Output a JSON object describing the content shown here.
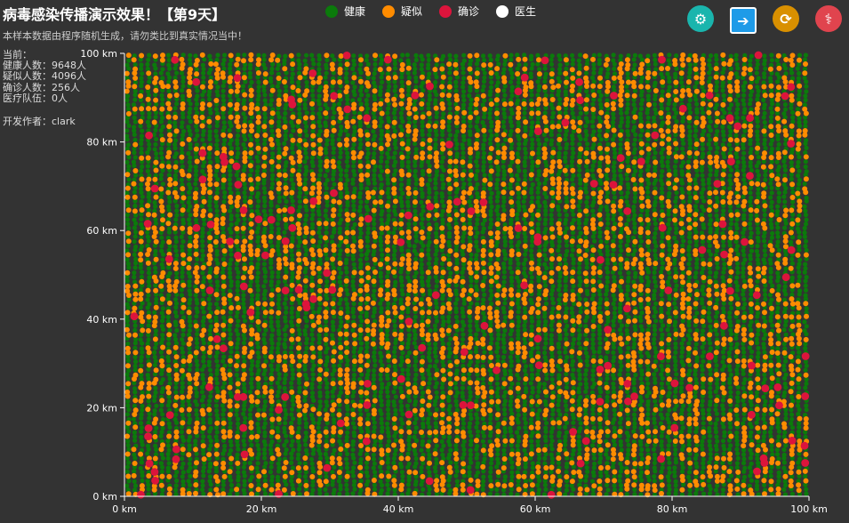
{
  "header": {
    "title": "病毒感染传播演示效果！【第9天】",
    "subtitle": "本样本数据由程序随机生成，请勿类比到真实情况当中！"
  },
  "stats": {
    "label": "当前：",
    "healthy": "健康人数：9648人",
    "suspected": "疑似人数：4096人",
    "confirmed": "确诊人数：256人",
    "medical": "医疗队伍：0人",
    "author": "开发作者：clark"
  },
  "legend": [
    {
      "label": "健康",
      "color": "#0b7a0b"
    },
    {
      "label": "疑似",
      "color": "#ff8c00"
    },
    {
      "label": "确诊",
      "color": "#dc143c"
    },
    {
      "label": "医生",
      "color": "#ffffff"
    }
  ],
  "toolbar": [
    {
      "icon": "gear-icon",
      "color": "#1ab5ad",
      "glyph": "⚙"
    },
    {
      "icon": "arrow-right-box-icon",
      "color": "#1e9be8",
      "glyph": "➔"
    },
    {
      "icon": "refresh-icon",
      "color": "#d99000",
      "glyph": "⟳"
    },
    {
      "icon": "doctor-icon",
      "color": "#e0444e",
      "glyph": "⚕"
    }
  ],
  "chart_data": {
    "type": "scatter",
    "xlim": [
      0,
      100
    ],
    "ylim": [
      0,
      100
    ],
    "xticks": [
      "0 km",
      "20 km",
      "40 km",
      "60 km",
      "80 km",
      "100 km"
    ],
    "yticks": [
      "0 km",
      "20 km",
      "40 km",
      "60 km",
      "80 km",
      "100 km"
    ],
    "series": [
      {
        "name": "健康",
        "count": 9648,
        "color": "#0b7a0b"
      },
      {
        "name": "疑似",
        "count": 4096,
        "color": "#ff8c00"
      },
      {
        "name": "确诊",
        "count": 256,
        "color": "#dc143c"
      },
      {
        "name": "医生",
        "count": 0,
        "color": "#ffffff"
      }
    ],
    "grid": false,
    "legend_position": "top"
  }
}
